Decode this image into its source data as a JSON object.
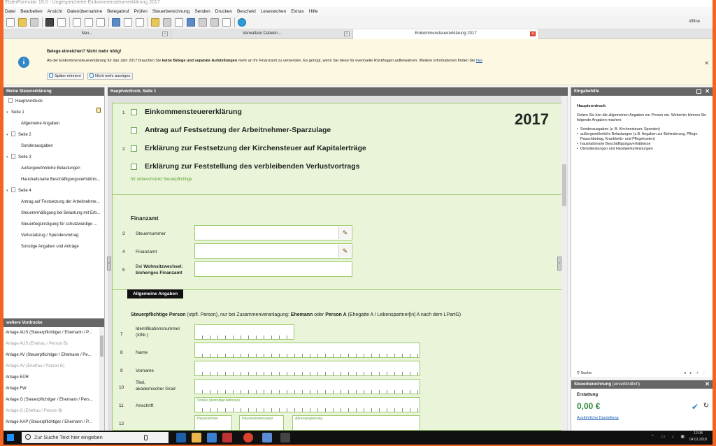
{
  "window": {
    "title": "ElsterFormular 19.0 - Ungespeicherte Einkommensteuererklärung 2017"
  },
  "menu": [
    "Datei",
    "Bearbeiten",
    "Ansicht",
    "Datenübernahme",
    "Belegabruf",
    "Prüfen",
    "Steuerberechnung",
    "Senden",
    "Drucken",
    "Bescheid",
    "Lesezeichen",
    "Extras",
    "Hilfe"
  ],
  "toolbar": {
    "status": "offline"
  },
  "tabs": [
    {
      "label": "Neu..."
    },
    {
      "label": "Verwaltete Dateien..."
    },
    {
      "label": "Einkommensteuererklärung 2017"
    }
  ],
  "infobar": {
    "title": "Belege einreichen? Nicht mehr nötig!",
    "text_pre": "Ab der Einkommensteuererklärung für das Jahr 2017 brauchen Sie ",
    "text_bold": "keine Belege und separate Aufstellungen",
    "text_post": " mehr an Ihr Finanzamt zu versenden. Es genügt, wenn Sie diese für eventuelle Rückfragen aufbewahren. Weitere Informationen finden Sie ",
    "link": "hier",
    "text_end": ".",
    "btn_later": "Später erinnern",
    "btn_never": "Nicht mehr anzeigen"
  },
  "left": {
    "header": "Meine Steuererklärung",
    "tree": [
      {
        "label": "Hauptvordruck",
        "level": 0,
        "arrow": ""
      },
      {
        "label": "Seite 1",
        "level": 1,
        "arrow": "▾"
      },
      {
        "label": "Allgemeine Angaben",
        "level": 2,
        "arrow": ""
      },
      {
        "label": "Seite 2",
        "level": 1,
        "arrow": "▾"
      },
      {
        "label": "Sonderausgaben",
        "level": 2,
        "arrow": ""
      },
      {
        "label": "Seite 3",
        "level": 1,
        "arrow": "▾"
      },
      {
        "label": "Außergewöhnliche Belastungen",
        "level": 2,
        "arrow": ""
      },
      {
        "label": "Haushaltsnahe Beschäftigungsverhältnis...",
        "level": 2,
        "arrow": ""
      },
      {
        "label": "Seite 4",
        "level": 1,
        "arrow": "▾"
      },
      {
        "label": "Antrag auf Festsetzung der Arbeitnehme...",
        "level": 2,
        "arrow": ""
      },
      {
        "label": "Steuerermäßigung bei Belastung mit Erb...",
        "level": 2,
        "arrow": ""
      },
      {
        "label": "Steuerbegünstigung für schutzwürdige ...",
        "level": 2,
        "arrow": ""
      },
      {
        "label": "Verlustabzug / Spendenvortrag",
        "level": 2,
        "arrow": ""
      },
      {
        "label": "Sonstige Angaben und Anträge",
        "level": 2,
        "arrow": ""
      }
    ],
    "forms_header": "weitere Vordrucke",
    "forms": [
      {
        "label": "Anlage AUS (Steuerpflichtiger / Ehemann / P...",
        "dim": false
      },
      {
        "label": "Anlage AUS (Ehefrau / Person B)",
        "dim": true
      },
      {
        "label": "Anlage AV (Steuerpflichtiger / Ehemann / Pe...",
        "dim": false
      },
      {
        "label": "Anlage AV (Ehefrau / Person B)",
        "dim": true
      },
      {
        "label": "Anlage EÜR",
        "dim": false
      },
      {
        "label": "Anlage FW",
        "dim": false
      },
      {
        "label": "Anlage G (Steuerpflichtiger / Ehemann / Pers...",
        "dim": false
      },
      {
        "label": "Anlage G (Ehefrau / Person B)",
        "dim": true
      },
      {
        "label": "Anlage KAP (Steuerpflichtiger / Ehemann / P...",
        "dim": false
      }
    ]
  },
  "center": {
    "header": "Hauptvordruck, Seite 1",
    "year": "2017",
    "options": [
      {
        "row": "1",
        "label": "Einkommensteuererklärung"
      },
      {
        "row": "",
        "label": "Antrag auf Festsetzung der Arbeitnehmer-Sparzulage"
      },
      {
        "row": "2",
        "label": "Erklärung zur Festsetzung der Kirchensteuer auf Kapitalerträge"
      },
      {
        "row": "",
        "label": "Erklärung zur Feststellung des verbleibenden Verlustvortrags"
      }
    ],
    "unlimited_note": "für unbeschränkt Steuerpflichtige",
    "finanzamt_title": "Finanzamt",
    "fields": {
      "r3": {
        "num": "3",
        "label": "Steuernummer"
      },
      "r4": {
        "num": "4",
        "label": "Finanzamt"
      },
      "r5": {
        "num": "5",
        "label_pre": "Bei ",
        "label_b1": "Wohnsitzwechsel:",
        "label_b2": "bisheriges Finanzamt"
      },
      "r7": {
        "num": "7",
        "label1": "Identifikationsnummer",
        "label2": "(IdNr.)"
      },
      "r8": {
        "num": "8",
        "label": "Name"
      },
      "r9": {
        "num": "9",
        "label": "Vorname"
      },
      "r10": {
        "num": "10",
        "label1": "Titel,",
        "label2": "akademischer Grad"
      },
      "r11": {
        "num": "11",
        "label": "Anschrift",
        "sub": "Straße (derzeitige Adresse)"
      },
      "r12": {
        "num": "12",
        "sub1": "Hausnummer",
        "sub2": "Hausnummerzusatz",
        "sub3": "Adressergänzung"
      }
    },
    "section": "Allgemeine Angaben",
    "person_b1": "Steuerpflichtige Person",
    "person_t1": " (stpfl. Person), nur bei Zusammenveranlagung: ",
    "person_b2": "Ehemann",
    "person_t2": " oder ",
    "person_b3": "Person A",
    "person_t3": " (Ehegatte A / Lebenspartner[in] A nach dem LPartG)"
  },
  "help": {
    "header": "Eingabehilfe",
    "title": "Hauptvordruck",
    "intro": "Geben Sie hier die allgemeinen Angaben zur Person ein. Weiterhin können Sie folgende Angaben machen:",
    "items": [
      "Sonderausgaben (z. B. Kirchensteuer, Spenden)",
      "außergewöhnliche Belastungen (z.B. Angaben zur Behinderung, Pflege-Pauschbetrag, Krankheits- und Pflegekosten)",
      "haushaltsnahe Beschäftigungsverhältnisse",
      "Dienstleistungen und Handwerkerleistungen"
    ],
    "search": "Suche"
  },
  "tax": {
    "header": "Steuerberechnung",
    "header_note": "(unverbindlich)",
    "label": "Erstattung",
    "amount": "0,00 €",
    "link": "Ausführliche Darstellung"
  },
  "taskbar": {
    "search_placeholder": "Zur Suche Text hier eingeben",
    "time": "12:08",
    "date": "04.01.2018"
  },
  "colors": {
    "accent": "#f26522",
    "form_bg": "#eaf4d8",
    "form_border": "#9ccb6e",
    "refund": "#2e8b3a"
  }
}
